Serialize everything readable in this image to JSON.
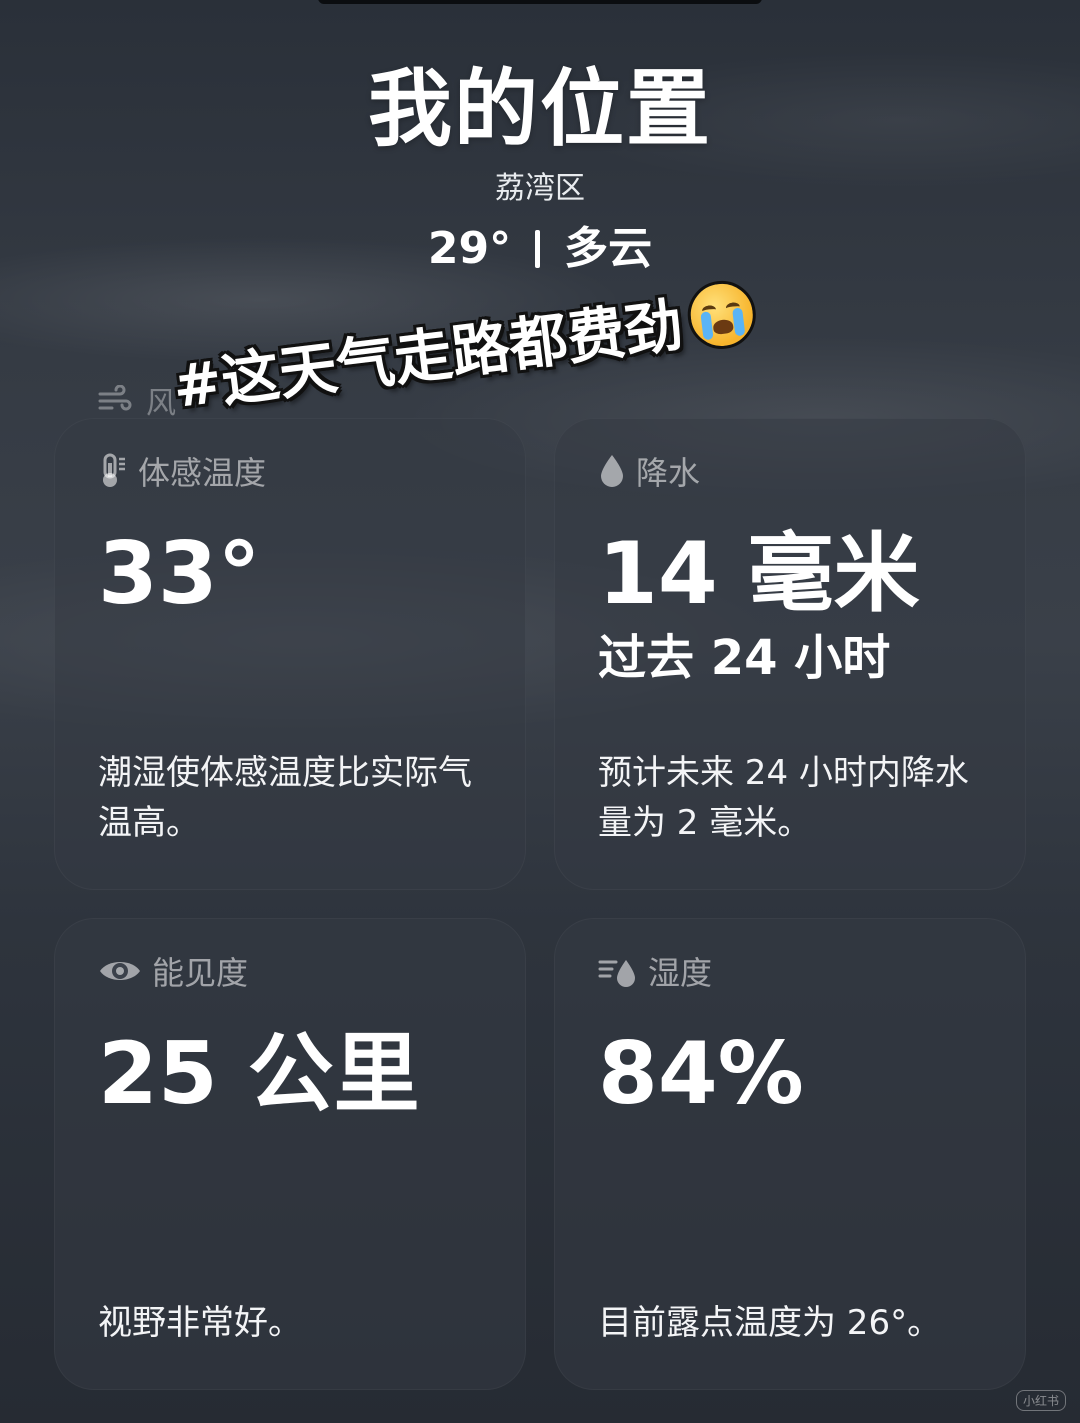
{
  "location": {
    "title": "我的位置",
    "district": "荔湾区",
    "temperature": "29°",
    "condition": "多云"
  },
  "ghost_label": "风",
  "caption": "#这天气走路都费劲",
  "cards": {
    "feels_like": {
      "label": "体感温度",
      "value": "33°",
      "description": "潮湿使体感温度比实际气温高。",
      "icon": "thermometer-icon"
    },
    "precipitation": {
      "label": "降水",
      "value": "14 毫米",
      "sub": "过去 24 小时",
      "description": "预计未来 24 小时内降水量为 2 毫米。",
      "icon": "raindrop-icon"
    },
    "visibility": {
      "label": "能见度",
      "value": "25 公里",
      "description": "视野非常好。",
      "icon": "eye-icon"
    },
    "humidity": {
      "label": "湿度",
      "value": "84%",
      "description": "目前露点温度为 26°。",
      "icon": "humidity-icon"
    }
  },
  "watermark": "小红书",
  "colors": {
    "background": "#2f353e",
    "card": "#3a404a",
    "text": "#ffffff",
    "muted": "#8c939c"
  }
}
